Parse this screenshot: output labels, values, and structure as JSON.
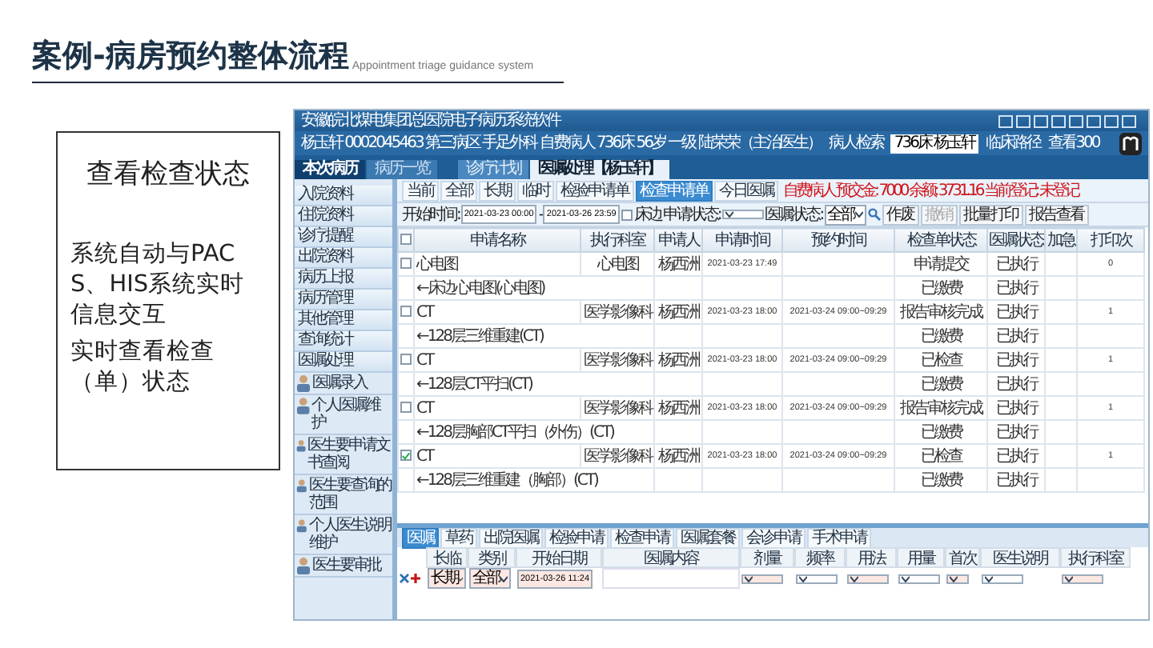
{
  "slide": {
    "title": "案例-病房预约整体流程",
    "subtitle": "Appointment triage guidance system"
  },
  "info_card": {
    "heading": "查看检查状态",
    "paragraphs": [
      "系统自动与PACS、HIS系统实时信息交互",
      "实时查看检查（单）状态"
    ]
  },
  "app": {
    "window_title": "安徽皖北煤电集团总医院电子病历系统软件",
    "patient_bar": {
      "info": "杨玉轩 0002045463 第三病区 手足外科 自费病人 736床 56岁 一级 陆荣荣（主治医生）",
      "search_link": "病人检索",
      "bed_select": "736床 杨玉轩",
      "links": [
        "临床路径",
        "查看300"
      ]
    },
    "top_tabs": [
      {
        "label": "本次病历",
        "selected": true
      },
      {
        "label": "病历一览",
        "selected": false
      }
    ],
    "doc_tabs": [
      {
        "label": "诊疗计划",
        "selected": false
      },
      {
        "label": "医嘱处理【杨玉轩】",
        "selected": true
      }
    ],
    "sidebar": {
      "sections": [
        "入院资料",
        "住院资料",
        "诊疗提醒",
        "出院资料",
        "病历上报",
        "病历管理",
        "其他管理",
        "查询统计",
        "医嘱处理"
      ],
      "tools": [
        "医嘱录入",
        "个人医嘱维护",
        "医生要申请文书查阅",
        "医生要查询的范围",
        "个人医生说明维护",
        "医生要审批"
      ]
    },
    "order_tabs": [
      {
        "label": "当前",
        "selected": false
      },
      {
        "label": "全部",
        "selected": false
      },
      {
        "label": "长期",
        "selected": false
      },
      {
        "label": "临时",
        "selected": false
      },
      {
        "label": "检验申请单",
        "selected": false
      },
      {
        "label": "检查申请单",
        "selected": true
      },
      {
        "label": "今日医嘱",
        "selected": false
      }
    ],
    "alert": "自费病人 预交金: 7000 余额: 3731.16 当前登记: 未登记",
    "filter": {
      "start_label": "开始时间:",
      "start": "2021-03-23 00:00",
      "dash": "-",
      "end": "2021-03-26 23:59",
      "bedside": {
        "label": "床边",
        "checked": false
      },
      "request_status_label": "申请状态:",
      "order_status_label": "医嘱状态:",
      "order_status": "全部",
      "buttons": [
        "作废",
        "撤销",
        "批量打印",
        "报告查看"
      ]
    },
    "table": {
      "select_all_checked": false,
      "columns": [
        "申请名称",
        "执行科室",
        "申请人",
        "申请时间",
        "预约时间",
        "检查单状态",
        "医嘱状态",
        "加急",
        "打印次"
      ],
      "rows": [
        {
          "checked": false,
          "name": "心电图",
          "dept": "心电图",
          "applicant": "杨西洲",
          "time": "2021-03-23 17:49",
          "appt": "",
          "status": "申请提交",
          "order_status": "已执行",
          "print": "0",
          "sub": {
            "name": "←床边心电图(心电图)",
            "status": "已缴费",
            "order_status": "已执行"
          }
        },
        {
          "checked": false,
          "name": "CT",
          "dept": "医学影像科",
          "applicant": "杨西洲",
          "time": "2021-03-23 18:00",
          "appt": "2021-03-24 09:00~09:29",
          "status": "报告审核完成",
          "order_status": "已执行",
          "print": "1",
          "sub": {
            "name": "←128层三维重建(CT)",
            "status": "已缴费",
            "order_status": "已执行"
          }
        },
        {
          "checked": false,
          "name": "CT",
          "dept": "医学影像科",
          "applicant": "杨西洲",
          "time": "2021-03-23 18:00",
          "appt": "2021-03-24 09:00~09:29",
          "status": "已检查",
          "order_status": "已执行",
          "print": "1",
          "sub": {
            "name": "←128层CT平扫(CT)",
            "status": "已缴费",
            "order_status": "已执行"
          }
        },
        {
          "checked": false,
          "name": "CT",
          "dept": "医学影像科",
          "applicant": "杨西洲",
          "time": "2021-03-23 18:00",
          "appt": "2021-03-24 09:00~09:29",
          "status": "报告审核完成",
          "order_status": "已执行",
          "print": "1",
          "sub": {
            "name": "←128层胸部CT平扫（外伤）(CT)",
            "status": "已缴费",
            "order_status": "已执行"
          }
        },
        {
          "checked": true,
          "name": "CT",
          "dept": "医学影像科",
          "applicant": "杨西洲",
          "time": "2021-03-23 18:00",
          "appt": "2021-03-24 09:00~09:29",
          "status": "已检查",
          "order_status": "已执行",
          "print": "1",
          "sub": {
            "name": "←128层三维重建（胸部）(CT)",
            "status": "已缴费",
            "order_status": "已执行"
          }
        }
      ]
    },
    "entry_tabs": [
      {
        "label": "医嘱",
        "selected": true
      },
      {
        "label": "草药",
        "selected": false
      },
      {
        "label": "出院医嘱",
        "selected": false
      },
      {
        "label": "检验申请",
        "selected": false
      },
      {
        "label": "检查申请",
        "selected": false
      },
      {
        "label": "医嘱套餐",
        "selected": false
      },
      {
        "label": "会诊申请",
        "selected": false
      },
      {
        "label": "手术申请",
        "selected": false
      }
    ],
    "entry": {
      "columns": [
        "长临",
        "类别",
        "开始日期",
        "医嘱内容",
        "剂量",
        "频率",
        "用法",
        "用量",
        "首次",
        "医生说明",
        "执行科室"
      ],
      "term": "长期",
      "category": "全部",
      "start": "2021-03-26 11:24"
    }
  }
}
